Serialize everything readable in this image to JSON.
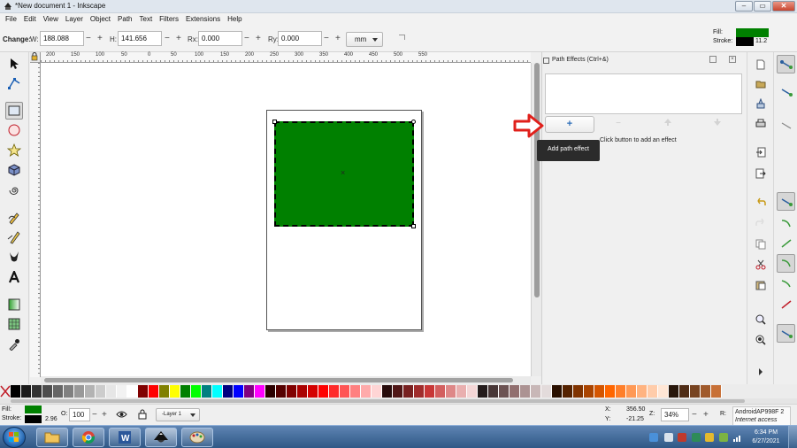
{
  "window": {
    "title": "*New document 1 - Inkscape",
    "min": "–",
    "max": "▭",
    "close": "✕"
  },
  "menu": [
    "File",
    "Edit",
    "View",
    "Layer",
    "Object",
    "Path",
    "Text",
    "Filters",
    "Extensions",
    "Help"
  ],
  "controls": {
    "change_label": "Change:",
    "w_label": "W:",
    "w_value": "188.088",
    "h_label": "H:",
    "h_value": "141.656",
    "rx_label": "Rx:",
    "rx_value": "0.000",
    "ry_label": "Ry:",
    "ry_value": "0.000",
    "unit": "mm",
    "minus": "−",
    "plus": "+"
  },
  "fill_stroke": {
    "fill_label": "Fill:",
    "stroke_label": "Stroke:",
    "stroke_width": "11.2",
    "fill_color": "#008000",
    "stroke_color": "#000000"
  },
  "ruler_top_numbers": [
    "200",
    "150",
    "100",
    "50",
    "0",
    "50",
    "100",
    "150",
    "200",
    "250",
    "300",
    "350",
    "400",
    "450",
    "500",
    "550"
  ],
  "ruler_left_numbers": [
    "1",
    "0",
    "0",
    "5",
    "0",
    "0",
    "5",
    "0",
    "1",
    "0",
    "0"
  ],
  "panel": {
    "title": "Path Effects (Ctrl+&)",
    "add_symbol": "+",
    "remove_symbol": "−",
    "hint": "Click button to add an effect",
    "tooltip": "Add path effect"
  },
  "status": {
    "fill_label": "Fill:",
    "stroke_label": "Stroke:",
    "stroke_width": "2.96",
    "opacity_label": "O:",
    "opacity_value": "100",
    "layer": "-Layer 1",
    "x_label": "X:",
    "x_value": "356.50",
    "y_label": "Y:",
    "y_value": "-21.25",
    "z_label": "Z:",
    "zoom": "34%",
    "r_label": "R:",
    "net_line1": "AndroidAP998F 2",
    "net_line2": "Internet access"
  },
  "taskbar": {
    "time": "6:34 PM",
    "date": "6/27/2021"
  },
  "palette": [
    "#000000",
    "#1a1a1a",
    "#333333",
    "#4d4d4d",
    "#666666",
    "#808080",
    "#999999",
    "#b3b3b3",
    "#cccccc",
    "#e6e6e6",
    "#f2f2f2",
    "#ffffff",
    "#800000",
    "#ff0000",
    "#808000",
    "#ffff00",
    "#008000",
    "#00ff00",
    "#008080",
    "#00ffff",
    "#000080",
    "#0000ff",
    "#800080",
    "#ff00ff",
    "#2b0000",
    "#550000",
    "#800000",
    "#aa0000",
    "#d40000",
    "#ff0000",
    "#ff2a2a",
    "#ff5555",
    "#ff8080",
    "#ffaaaa",
    "#ffd5d5",
    "#280b0b",
    "#501616",
    "#782121",
    "#a02c2c",
    "#c83737",
    "#d35f5f",
    "#de8787",
    "#e9afaf",
    "#f4d7d7",
    "#241c1c",
    "#483737",
    "#6c5353",
    "#916f6f",
    "#ac9393",
    "#c8b7b7",
    "#e3dbdb",
    "#2b1100",
    "#552200",
    "#803300",
    "#aa4400",
    "#d45500",
    "#ff6600",
    "#ff7f2a",
    "#ff9955",
    "#ffb380",
    "#ffccaa",
    "#ffe6d5",
    "#28170b",
    "#502d16",
    "#784421",
    "#a05a2c",
    "#c87137"
  ]
}
